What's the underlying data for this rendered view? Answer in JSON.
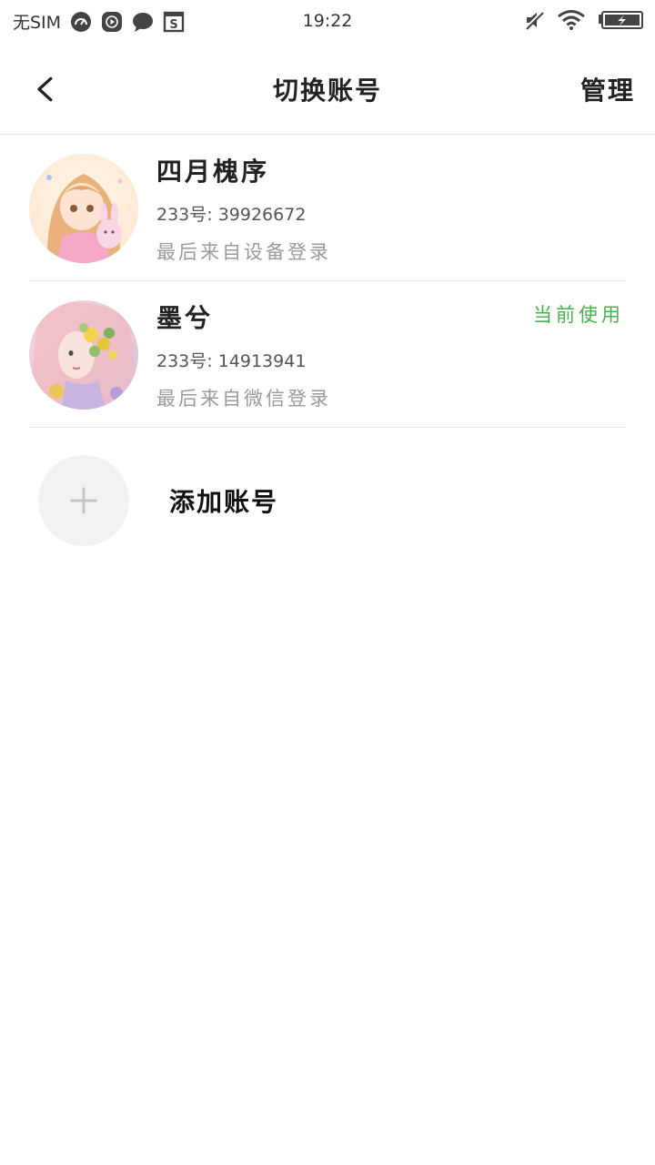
{
  "status_bar": {
    "carrier": "无SIM",
    "time": "19:22",
    "left_icons": [
      "dashboard-app-icon",
      "play-app-icon",
      "chat-bubble-icon",
      "s-app-icon"
    ],
    "right_icons": [
      "mute-icon",
      "wifi-icon",
      "battery-charging-icon"
    ]
  },
  "header": {
    "back_icon": "chevron-left-icon",
    "title": "切换账号",
    "manage_label": "管理"
  },
  "accounts": [
    {
      "name": "四月槐序",
      "id_text": "233号: 39926672",
      "login_text": "最后来自设备登录",
      "current_label": ""
    },
    {
      "name": "墨兮",
      "id_text": "233号: 14913941",
      "login_text": "最后来自微信登录",
      "current_label": "当前使用"
    }
  ],
  "add_account": {
    "icon": "plus-icon",
    "label": "添加账号"
  },
  "colors": {
    "accent_green": "#4caf50",
    "divider": "#e6e6e6",
    "muted_text": "#9a9a9a"
  }
}
